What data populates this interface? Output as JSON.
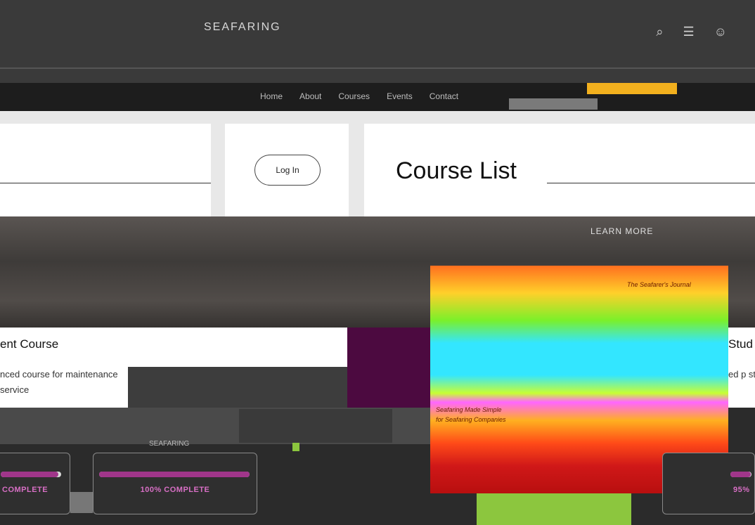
{
  "header": {
    "site_name": "SEAFARING",
    "tools": [
      "⌕",
      "☰",
      "☺"
    ]
  },
  "nav": {
    "links": [
      "Home",
      "About",
      "Courses",
      "Events",
      "Contact"
    ],
    "cta_label": "",
    "subtab_label": ""
  },
  "hero": {
    "login_label": "Log In",
    "page_title": "Course List"
  },
  "banner": {
    "link_text": "LEARN MORE"
  },
  "featured": {
    "caption_top": "The Seafarer's Journal",
    "caption_mid": "Seafaring Made Simple",
    "caption_low": "for Seafaring Companies"
  },
  "courses": {
    "left": {
      "title": "ent Course",
      "description": "nced course for maintenance service"
    },
    "right": {
      "title": "Stud",
      "description": "ed p stude"
    }
  },
  "progress": {
    "sub_label": "SEAFARING",
    "cards": [
      {
        "label": "COMPLETE",
        "percent": 95
      },
      {
        "label": "100% COMPLETE",
        "percent": 100
      },
      {
        "label": "95%",
        "percent": 95
      }
    ]
  },
  "colors": {
    "accent": "#f2b01e",
    "progress": "#a0368a",
    "purple": "#4c0a40",
    "green": "#8cc63e"
  }
}
